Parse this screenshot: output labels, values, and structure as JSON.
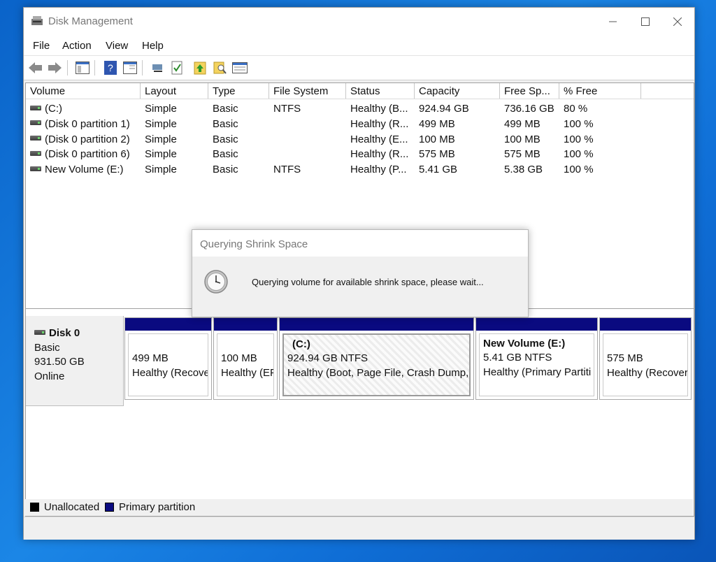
{
  "window": {
    "title": "Disk Management"
  },
  "menu": [
    "File",
    "Action",
    "View",
    "Help"
  ],
  "toolbar_icons": [
    "back-arrow-icon",
    "forward-arrow-icon",
    "console-tree-icon",
    "help-icon",
    "properties-icon",
    "connect-icon",
    "check-icon",
    "up-icon",
    "search-icon",
    "list-icon"
  ],
  "columns": [
    "Volume",
    "Layout",
    "Type",
    "File System",
    "Status",
    "Capacity",
    "Free Sp...",
    "% Free"
  ],
  "volumes": [
    {
      "volume": "(C:)",
      "layout": "Simple",
      "type": "Basic",
      "fs": "NTFS",
      "status": "Healthy (B...",
      "capacity": "924.94 GB",
      "free": "736.16 GB",
      "pct": "80 %"
    },
    {
      "volume": "(Disk 0 partition 1)",
      "layout": "Simple",
      "type": "Basic",
      "fs": "",
      "status": "Healthy (R...",
      "capacity": "499 MB",
      "free": "499 MB",
      "pct": "100 %"
    },
    {
      "volume": "(Disk 0 partition 2)",
      "layout": "Simple",
      "type": "Basic",
      "fs": "",
      "status": "Healthy (E...",
      "capacity": "100 MB",
      "free": "100 MB",
      "pct": "100 %"
    },
    {
      "volume": "(Disk 0 partition 6)",
      "layout": "Simple",
      "type": "Basic",
      "fs": "",
      "status": "Healthy (R...",
      "capacity": "575 MB",
      "free": "575 MB",
      "pct": "100 %"
    },
    {
      "volume": "New Volume (E:)",
      "layout": "Simple",
      "type": "Basic",
      "fs": "NTFS",
      "status": "Healthy (P...",
      "capacity": "5.41 GB",
      "free": "5.38 GB",
      "pct": "100 %"
    }
  ],
  "disk": {
    "name": "Disk 0",
    "kind": "Basic",
    "size": "931.50 GB",
    "state": "Online"
  },
  "partitions": [
    {
      "title": "",
      "size": "499 MB",
      "status": "Healthy (Recove"
    },
    {
      "title": "",
      "size": "100 MB",
      "status": "Healthy (EF"
    },
    {
      "title": "(C:)",
      "size": "924.94 GB NTFS",
      "status": "Healthy (Boot, Page File, Crash Dump,"
    },
    {
      "title": "New Volume  (E:)",
      "size": "5.41 GB NTFS",
      "status": "Healthy (Primary Partiti"
    },
    {
      "title": "",
      "size": "575 MB",
      "status": "Healthy (Recover"
    }
  ],
  "legend": [
    {
      "label": "Unallocated",
      "color": "#000000"
    },
    {
      "label": "Primary partition",
      "color": "#0a0a80"
    }
  ],
  "dialog": {
    "title": "Querying Shrink Space",
    "message": "Querying volume for available shrink space, please wait..."
  },
  "colors": {
    "partition_bar": "#0a0a80",
    "desktop": "#1b86e6"
  }
}
